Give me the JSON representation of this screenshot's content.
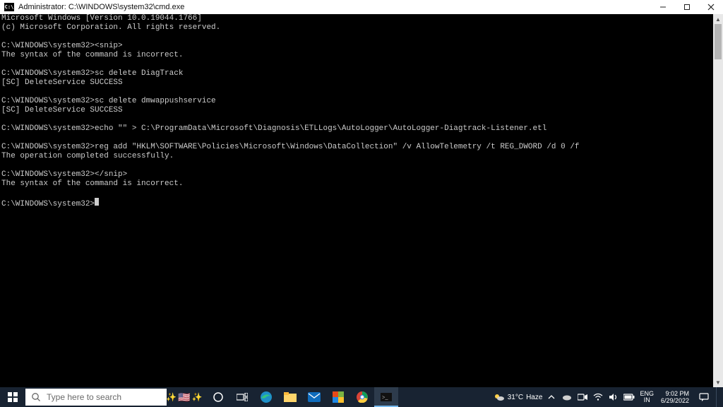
{
  "titlebar": {
    "icon_label": "C:\\",
    "title": "Administrator: C:\\WINDOWS\\system32\\cmd.exe"
  },
  "console": {
    "lines": [
      "Microsoft Windows [Version 10.0.19044.1766]",
      "(c) Microsoft Corporation. All rights reserved.",
      "",
      "C:\\WINDOWS\\system32><snip>",
      "The syntax of the command is incorrect.",
      "",
      "C:\\WINDOWS\\system32>sc delete DiagTrack",
      "[SC] DeleteService SUCCESS",
      "",
      "C:\\WINDOWS\\system32>sc delete dmwappushservice",
      "[SC] DeleteService SUCCESS",
      "",
      "C:\\WINDOWS\\system32>echo \"\" > C:\\ProgramData\\Microsoft\\Diagnosis\\ETLLogs\\AutoLogger\\AutoLogger-Diagtrack-Listener.etl",
      "",
      "C:\\WINDOWS\\system32>reg add \"HKLM\\SOFTWARE\\Policies\\Microsoft\\Windows\\DataCollection\" /v AllowTelemetry /t REG_DWORD /d 0 /f",
      "The operation completed successfully.",
      "",
      "C:\\WINDOWS\\system32></snip>",
      "The syntax of the command is incorrect.",
      "",
      "C:\\WINDOWS\\system32>"
    ]
  },
  "taskbar": {
    "search_placeholder": "Type here to search",
    "weather_temp": "31°C",
    "weather_desc": "Haze",
    "lang_top": "ENG",
    "lang_bottom": "IN",
    "clock_time": "9:02 PM",
    "clock_date": "6/29/2022"
  }
}
